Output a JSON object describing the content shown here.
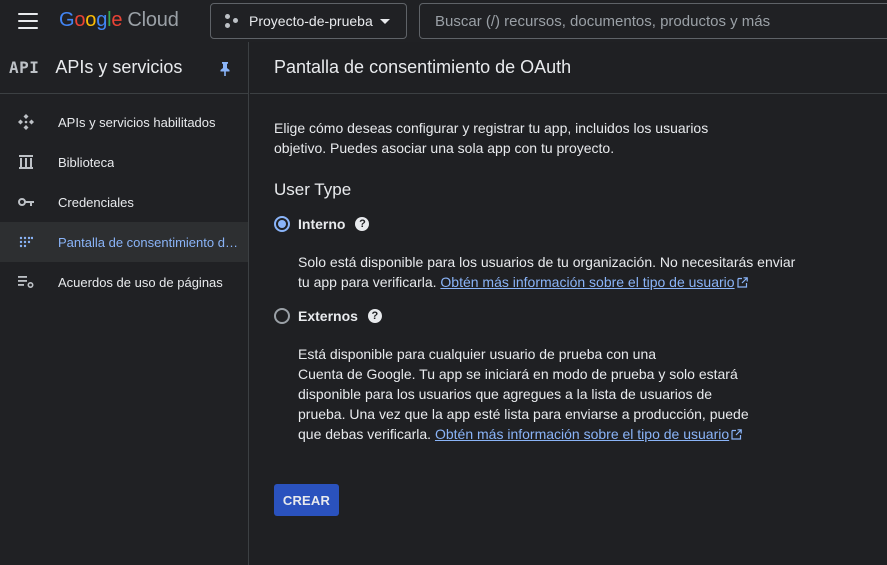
{
  "header": {
    "logo_google": [
      "G",
      "o",
      "o",
      "g",
      "l",
      "e"
    ],
    "logo_cloud": "Cloud",
    "project_name": "Proyecto-de-prueba",
    "search_placeholder": "Buscar (/) recursos, documentos, productos y más"
  },
  "sidebar": {
    "badge": "API",
    "title": "APIs y servicios",
    "items": [
      {
        "label": "APIs y servicios habilitados",
        "icon": "api-diamond-icon",
        "active": false
      },
      {
        "label": "Biblioteca",
        "icon": "library-icon",
        "active": false
      },
      {
        "label": "Credenciales",
        "icon": "key-icon",
        "active": false
      },
      {
        "label": "Pantalla de consentimiento de OAuth",
        "icon": "consent-dots-icon",
        "active": true
      },
      {
        "label": "Acuerdos de uso de páginas",
        "icon": "settings-list-icon",
        "active": false
      }
    ]
  },
  "main": {
    "title": "Pantalla de consentimiento de OAuth",
    "intro": "Elige cómo deseas configurar y registrar tu app, incluidos los usuarios objetivo. Puedes asociar una sola app con tu proyecto.",
    "section_title": "User Type",
    "options": [
      {
        "label": "Interno",
        "checked": true,
        "description": "Solo está disponible para los usuarios de tu organización. No necesitarás enviar tu app para verificarla. ",
        "link": "Obtén más información sobre el tipo de usuario"
      },
      {
        "label": "Externos",
        "checked": false,
        "description_lines": [
          "Está disponible para cualquier usuario de prueba con una",
          "Cuenta de Google. Tu app se iniciará en modo de prueba y solo estará",
          "disponible para los usuarios que agregues a la lista de usuarios de",
          "prueba. Una vez que la app esté lista para enviarse a producción, puede"
        ],
        "description_last": "que debas verificarla. ",
        "link": "Obtén más información sobre el tipo de usuario"
      }
    ],
    "create_label": "CREAR",
    "help_glyph": "?"
  },
  "colors": {
    "accent": "#8ab4f8",
    "button": "#2a52be",
    "background": "#1f2023"
  }
}
